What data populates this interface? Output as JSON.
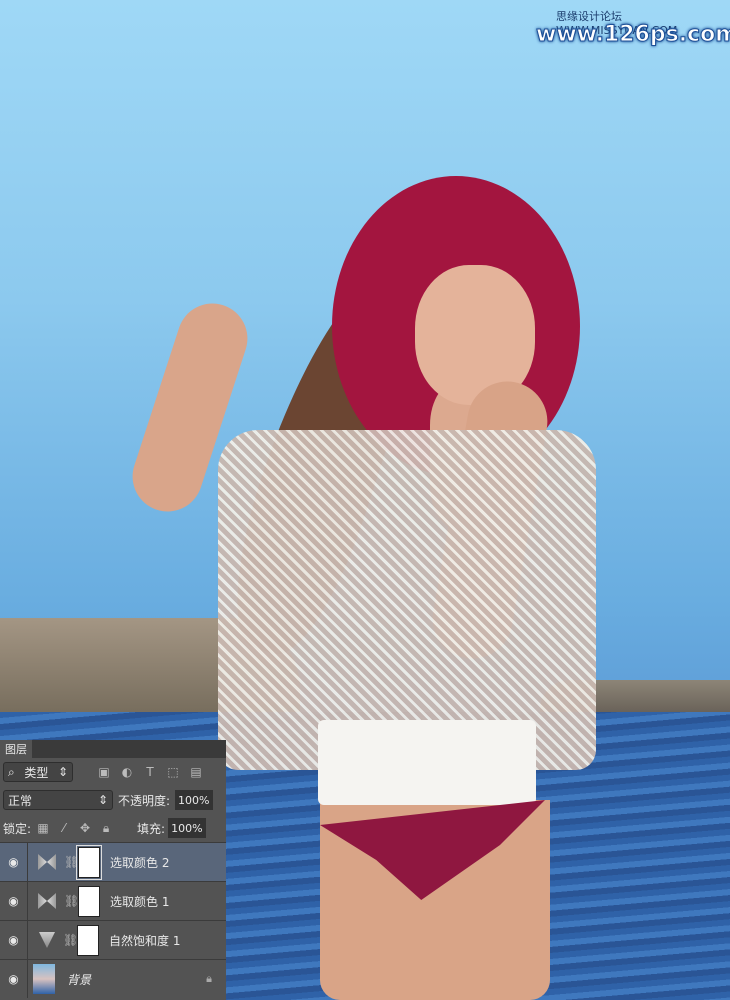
{
  "watermark": {
    "site_cn": "思缘设计论坛 WWW.MISSYUAN.COM",
    "site_en": "www.126ps.com"
  },
  "layers_panel": {
    "tab": "图层",
    "filter": {
      "value": "类型",
      "icons": [
        "image-icon",
        "adjustment-icon",
        "type-icon",
        "shape-icon",
        "smart-object-icon"
      ]
    },
    "blend_mode": "正常",
    "opacity_label": "不透明度:",
    "opacity": "100%",
    "lock_label": "锁定:",
    "fill_label": "填充:",
    "fill": "100%",
    "layers": [
      {
        "name": "选取颜色 2",
        "type": "selective-color",
        "active": true
      },
      {
        "name": "选取颜色 1",
        "type": "selective-color",
        "active": false
      },
      {
        "name": "自然饱和度 1",
        "type": "vibrance",
        "active": false
      },
      {
        "name": "背景",
        "type": "background",
        "active": false
      }
    ]
  }
}
